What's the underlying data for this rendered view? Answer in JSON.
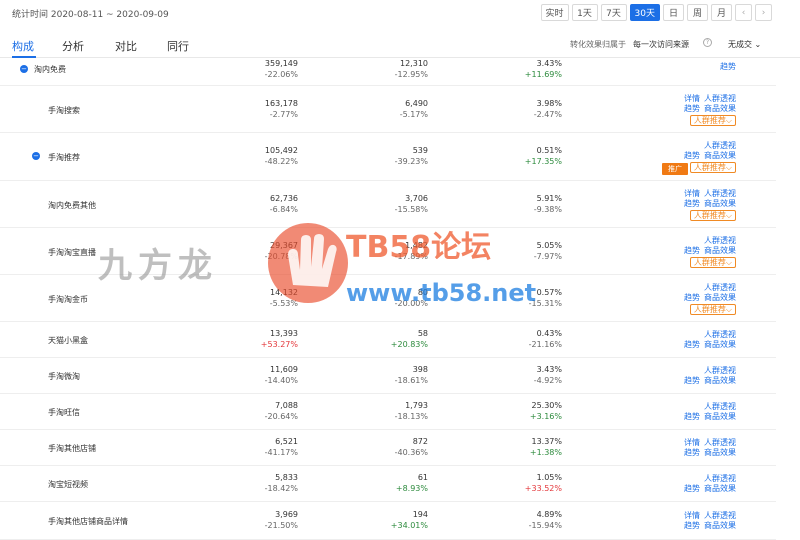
{
  "header": {
    "date_range": "统计时间 2020-08-11 ~ 2020-09-09",
    "periods": [
      "实时",
      "1天",
      "7天",
      "30天",
      "日",
      "周",
      "月"
    ],
    "active_period": "30天",
    "prev_icon": "chevron-left-icon",
    "next_icon": "chevron-right-icon"
  },
  "tabs": [
    "构成",
    "分析",
    "对比",
    "同行"
  ],
  "active_tab": "构成",
  "attribution": {
    "label": "转化效果归属于",
    "value": "每一次访问来源",
    "help_icon": "question-circle-icon",
    "metric": "无成交 ⌄"
  },
  "rows": [
    {
      "name": "淘内免费",
      "v1": "359,149",
      "c1": "-22.06%",
      "v2": "12,310",
      "c2": "-12.95%",
      "v3": "3.43%",
      "c3": "+11.69%",
      "links": [
        [
          "趋势"
        ]
      ],
      "crowd": false,
      "promo": false,
      "expand": true
    },
    {
      "name": "手淘搜索",
      "v1": "163,178",
      "c1": "-2.77%",
      "v2": "6,490",
      "c2": "-5.17%",
      "v3": "3.98%",
      "c3": "-2.47%",
      "links": [
        [
          "详情",
          "人群透视"
        ],
        [
          "趋势",
          "商品效果"
        ]
      ],
      "crowd": true,
      "promo": false,
      "expand": false
    },
    {
      "name": "手淘推荐",
      "v1": "105,492",
      "c1": "-48.22%",
      "v2": "539",
      "c2": "-39.23%",
      "v3": "0.51%",
      "c3": "+17.35%",
      "links": [
        [
          "人群透视"
        ],
        [
          "趋势",
          "商品效果"
        ]
      ],
      "crowd": true,
      "promo": true,
      "expand": true
    },
    {
      "name": "淘内免费其他",
      "v1": "62,736",
      "c1": "-6.84%",
      "v2": "3,706",
      "c2": "-15.58%",
      "v3": "5.91%",
      "c3": "-9.38%",
      "links": [
        [
          "详情",
          "人群透视"
        ],
        [
          "趋势",
          "商品效果"
        ]
      ],
      "crowd": true,
      "promo": false,
      "expand": false
    },
    {
      "name": "手淘淘宝直播",
      "v1": "29,367",
      "c1": "-20.78%",
      "v2": "1,482",
      "c2": "-17.89%",
      "v3": "5.05%",
      "c3": "-7.97%",
      "links": [
        [
          "人群透视"
        ],
        [
          "趋势",
          "商品效果"
        ]
      ],
      "crowd": true,
      "promo": false,
      "expand": false
    },
    {
      "name": "手淘淘金币",
      "v1": "14,132",
      "c1": "-5.53%",
      "v2": "80",
      "c2": "-20.00%",
      "v3": "0.57%",
      "c3": "-15.31%",
      "links": [
        [
          "人群透视"
        ],
        [
          "趋势",
          "商品效果"
        ]
      ],
      "crowd": true,
      "promo": false,
      "expand": false
    },
    {
      "name": "天猫小黑盒",
      "v1": "13,393",
      "c1": "+53.27%",
      "v2": "58",
      "c2": "+20.83%",
      "v3": "0.43%",
      "c3": "-21.16%",
      "links": [
        [
          "人群透视"
        ],
        [
          "趋势",
          "商品效果"
        ]
      ],
      "crowd": false,
      "promo": false,
      "expand": false
    },
    {
      "name": "手淘微淘",
      "v1": "11,609",
      "c1": "-14.40%",
      "v2": "398",
      "c2": "-18.61%",
      "v3": "3.43%",
      "c3": "-4.92%",
      "links": [
        [
          "人群透视"
        ],
        [
          "趋势",
          "商品效果"
        ]
      ],
      "crowd": false,
      "promo": false,
      "expand": false
    },
    {
      "name": "手淘旺信",
      "v1": "7,088",
      "c1": "-20.64%",
      "v2": "1,793",
      "c2": "-18.13%",
      "v3": "25.30%",
      "c3": "+3.16%",
      "links": [
        [
          "人群透视"
        ],
        [
          "趋势",
          "商品效果"
        ]
      ],
      "crowd": false,
      "promo": false,
      "expand": false
    },
    {
      "name": "手淘其他店铺",
      "v1": "6,521",
      "c1": "-41.17%",
      "v2": "872",
      "c2": "-40.36%",
      "v3": "13.37%",
      "c3": "+1.38%",
      "links": [
        [
          "详情",
          "人群透视"
        ],
        [
          "趋势",
          "商品效果"
        ]
      ],
      "crowd": false,
      "promo": false,
      "expand": false
    },
    {
      "name": "淘宝短视频",
      "v1": "5,833",
      "c1": "-18.42%",
      "v2": "61",
      "c2": "+8.93%",
      "v3": "1.05%",
      "c3": "+33.52%",
      "links": [
        [
          "人群透视"
        ],
        [
          "趋势",
          "商品效果"
        ]
      ],
      "crowd": false,
      "promo": false,
      "expand": false
    },
    {
      "name": "手淘其他店铺商品详情",
      "v1": "3,969",
      "c1": "-21.50%",
      "v2": "194",
      "c2": "+34.01%",
      "v3": "4.89%",
      "c3": "-15.94%",
      "links": [
        [
          "详情",
          "人群透视"
        ],
        [
          "趋势",
          "商品效果"
        ]
      ],
      "crowd": false,
      "promo": false,
      "expand": false
    }
  ],
  "labels": {
    "crowd_recommend": "人群推荐⌵",
    "promo": "推广",
    "expand_symbol": "−"
  },
  "watermark": {
    "left_text": "九方龙",
    "brand": "TB58论坛",
    "url": "www.tb58.net"
  },
  "colors": {
    "accent": "#1c6fe6",
    "positive": "#2e8b3e",
    "highlight_red": "#e4393c",
    "orange": "#f08a24"
  }
}
